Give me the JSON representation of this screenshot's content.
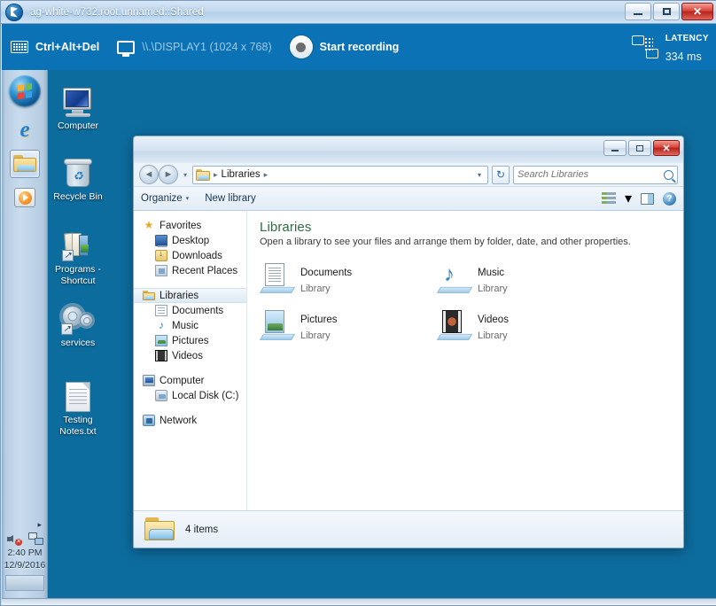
{
  "vnc_window": {
    "title": "ag-white-w732.root.unnamed::Shared",
    "minimize_label": "",
    "restore_label": "",
    "close_label": "✕"
  },
  "control_bar": {
    "ctrl_alt_del": "Ctrl+Alt+Del",
    "display": "\\\\.\\DISPLAY1 (1024 x 768)",
    "start_recording": "Start recording",
    "latency_title": "LATENCY",
    "latency_value": "334 ms"
  },
  "desktop": {
    "background_color": "#0d6c9e",
    "icons": [
      {
        "label": "Computer"
      },
      {
        "label": "Recycle Bin"
      },
      {
        "label": "Programs -\nShortcut",
        "line1": "Programs -",
        "line2": "Shortcut"
      },
      {
        "label": "services"
      },
      {
        "label": "Testing\nNotes.txt",
        "line1": "Testing",
        "line2": "Notes.txt"
      }
    ]
  },
  "taskbar": {
    "start_label": "Start",
    "items": [
      {
        "name": "Internet Explorer"
      },
      {
        "name": "Windows Explorer"
      },
      {
        "name": "Windows Media Player"
      }
    ],
    "tray": {
      "show_hidden": "▸",
      "volume": "muted",
      "network": "network",
      "time": "2:40 PM",
      "date": "12/9/2016"
    }
  },
  "explorer": {
    "window_buttons": {
      "minimize": "",
      "maximize": "",
      "close": "✕"
    },
    "address": {
      "back": "◄",
      "forward": "►",
      "history_caret": "▾",
      "crumb": "Libraries",
      "crumb_sep_left": "▸",
      "crumb_sep_right": "▸",
      "dropdown": "▾",
      "refresh": "↻"
    },
    "search": {
      "placeholder": "Search Libraries",
      "value": ""
    },
    "command_bar": {
      "organize": "Organize",
      "organize_caret": "▾",
      "new_library": "New library",
      "view_caret": "▾",
      "help": "?"
    },
    "nav_pane": [
      {
        "label": "Favorites",
        "icon": "star-icon",
        "level": 0,
        "selected": false
      },
      {
        "label": "Desktop",
        "icon": "desktop-icon",
        "level": 1,
        "selected": false
      },
      {
        "label": "Downloads",
        "icon": "downloads-icon",
        "level": 1,
        "selected": false
      },
      {
        "label": "Recent Places",
        "icon": "recent-places-icon",
        "level": 1,
        "selected": false
      },
      {
        "label": "Libraries",
        "icon": "library-icon",
        "level": 0,
        "selected": true
      },
      {
        "label": "Documents",
        "icon": "document-icon",
        "level": 1,
        "selected": false
      },
      {
        "label": "Music",
        "icon": "music-icon",
        "level": 1,
        "selected": false
      },
      {
        "label": "Pictures",
        "icon": "picture-icon",
        "level": 1,
        "selected": false
      },
      {
        "label": "Videos",
        "icon": "video-icon",
        "level": 1,
        "selected": false
      },
      {
        "label": "Computer",
        "icon": "computer-icon",
        "level": 0,
        "selected": false
      },
      {
        "label": "Local Disk (C:)",
        "icon": "disk-icon",
        "level": 1,
        "selected": false
      },
      {
        "label": "Network",
        "icon": "network-icon",
        "level": 0,
        "selected": false
      }
    ],
    "content": {
      "heading": "Libraries",
      "subheading": "Open a library to see your files and arrange them by folder, date, and other properties.",
      "items": [
        {
          "name": "Documents",
          "kind": "Library"
        },
        {
          "name": "Music",
          "kind": "Library"
        },
        {
          "name": "Pictures",
          "kind": "Library"
        },
        {
          "name": "Videos",
          "kind": "Library"
        }
      ]
    },
    "status": {
      "text": "4 items"
    }
  }
}
